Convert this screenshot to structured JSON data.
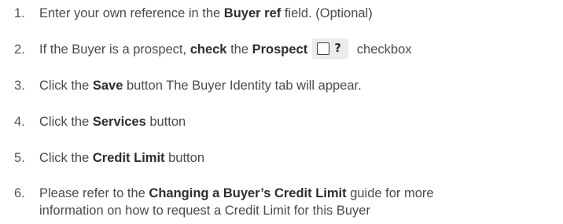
{
  "steps": [
    {
      "number": "1.",
      "t1": "Enter your own reference in the ",
      "b1": "Buyer ref",
      "t2": " field. (Optional)"
    },
    {
      "number": "2.",
      "t1": "If the Buyer is a prospect, ",
      "b1": "check",
      "t2": " the ",
      "b2": "Prospect",
      "checkbox_icon": "checkbox-unchecked-icon",
      "qmark": "?",
      "t3": " checkbox"
    },
    {
      "number": "3.",
      "t1": "Click the ",
      "b1": "Save",
      "t2": " button The Buyer Identity tab will appear."
    },
    {
      "number": "4.",
      "t1": "Click the ",
      "b1": "Services",
      "t2": " button"
    },
    {
      "number": "5.",
      "t1": "Click the ",
      "b1": "Credit Limit",
      "t2": " button"
    },
    {
      "number": "6.",
      "t1": "Please refer to the ",
      "b1": "Changing a Buyer’s Credit Limit",
      "t2": " guide for more",
      "line2": "information on how to request a Credit Limit for this Buyer"
    }
  ],
  "colors": {
    "text": "#4a4a4a",
    "bold_text": "#2e2e2e",
    "widget_background": "#ececec"
  }
}
